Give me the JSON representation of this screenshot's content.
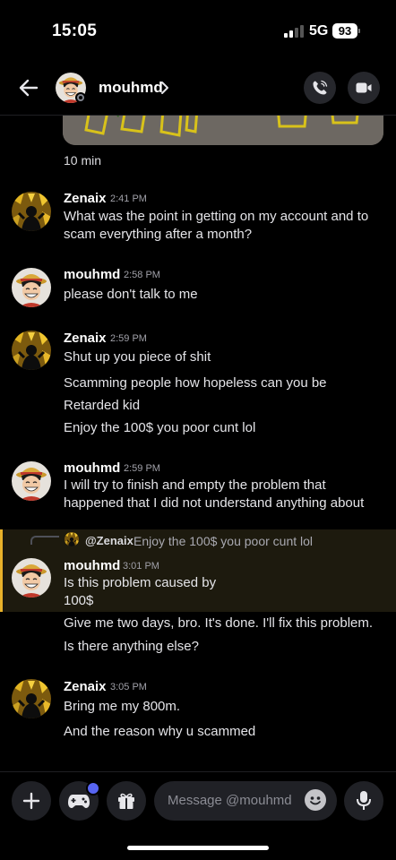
{
  "status_bar": {
    "time": "15:05",
    "network": "5G",
    "battery": "93"
  },
  "header": {
    "name": "mouhmd"
  },
  "chat": {
    "image_duration": "10 min",
    "groups": [
      {
        "author": "Zenaix",
        "time": "2:41 PM",
        "messages": [
          "What was the point in getting on my account and to scam everything after a month?"
        ]
      },
      {
        "author": "mouhmd",
        "time": "2:58 PM",
        "messages": [
          "please don't talk to me"
        ]
      },
      {
        "author": "Zenaix",
        "time": "2:59 PM",
        "messages": [
          "Shut up you piece of shit",
          "Scamming people how hopeless can you be",
          "Retarded kid",
          "Enjoy the 100$ you poor cunt lol"
        ]
      },
      {
        "author": "mouhmd",
        "time": "2:59 PM",
        "messages": [
          "I will try to finish and empty the problem that happened that I did not understand anything about"
        ]
      },
      {
        "author": "mouhmd",
        "time": "3:01 PM",
        "reply": {
          "mention": "@Zenaix",
          "text": "Enjoy the 100$ you poor cunt lol"
        },
        "messages": [
          "Is this problem caused by 100$",
          "Give me two days, bro. It's done. I'll fix this problem.",
          "Is there anything else?"
        ]
      },
      {
        "author": "Zenaix",
        "time": "3:05 PM",
        "messages": [
          "Bring me my 800m.",
          "And the reason why u scammed"
        ]
      }
    ]
  },
  "composer": {
    "placeholder": "Message @mouhmd"
  },
  "icons": {
    "back": "arrow-left-icon",
    "chevron": "chevron-right-icon",
    "call": "phone-icon",
    "video": "video-camera-icon",
    "add": "plus-icon",
    "games": "gamepad-icon",
    "gift": "gift-icon",
    "emoji": "emoji-icon",
    "mic": "microphone-icon"
  },
  "colors": {
    "background": "#000000",
    "highlight": "#1d1a0e",
    "highlight_bar": "#e8b12a",
    "accent": "#5865f2",
    "input": "#202126"
  }
}
